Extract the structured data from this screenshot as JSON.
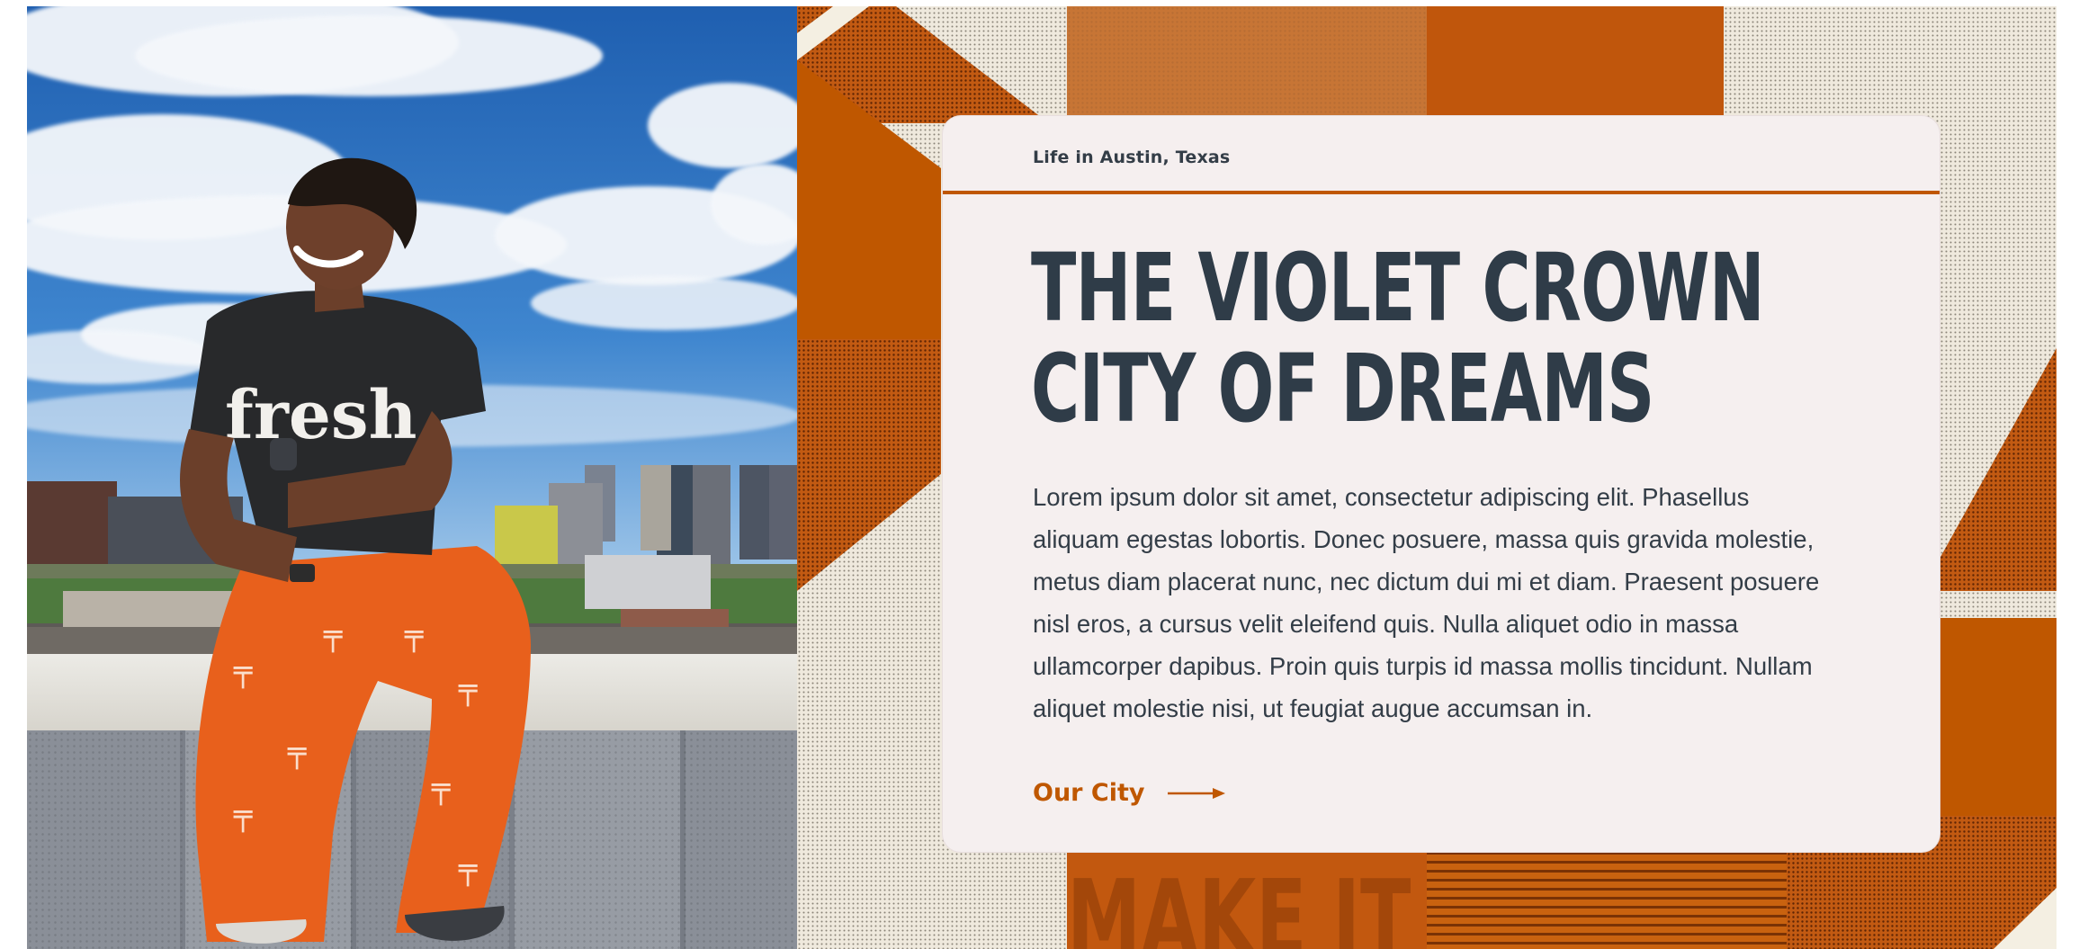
{
  "hero": {
    "eyebrow": "Life in Austin, Texas",
    "headline_lines": [
      "THE VIOLET CROWN",
      "CITY OF DREAMS"
    ],
    "body": "Lorem ipsum dolor sit amet, consectetur adipiscing elit. Phasellus aliquam egestas lobortis. Donec posuere, massa quis gravida molestie, metus diam placerat nunc, nec dictum dui mi et diam. Praesent posuere nisl eros, a cursus velit eleifend quis. Nulla aliquet odio in massa ullamcorper dapibus. Proin quis turpis id massa mollis tincidunt. Nullam aliquet molestie nisi, ut feugiat augue accumsan in.",
    "cta_label": "Our City",
    "cta_icon": "arrow-right-icon"
  },
  "photo": {
    "shirt_text": "fresh",
    "shirt_icon": "fresh-logo-text"
  },
  "background": {
    "poster_text": "MAKE IT"
  },
  "colors": {
    "burnt_orange": "#bf5700",
    "slate": "#333d47",
    "card_bg": "#f5efef"
  }
}
